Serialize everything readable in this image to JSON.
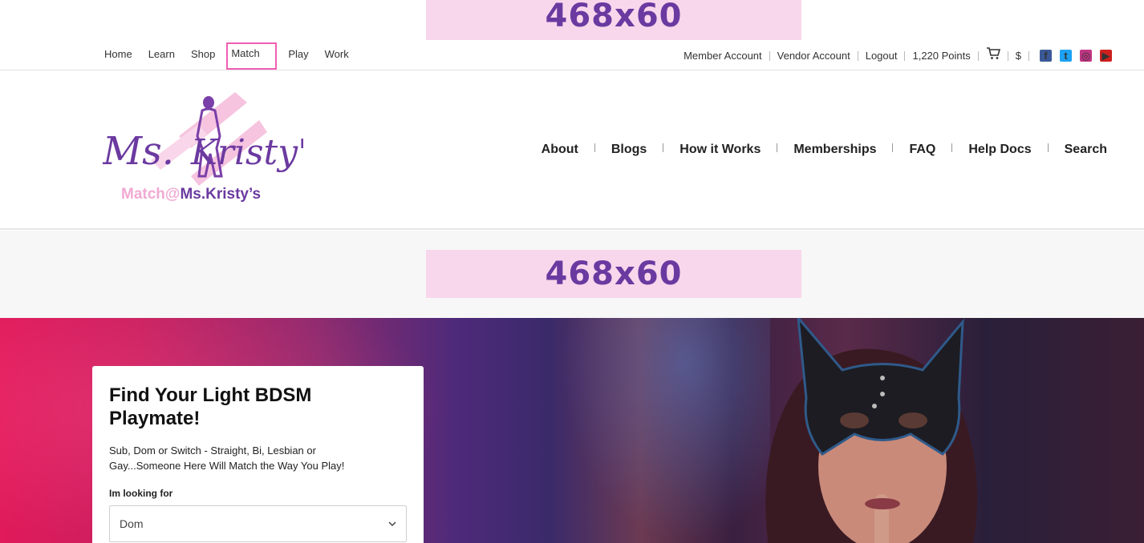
{
  "ads": {
    "top": "468x60",
    "middle": "468x60"
  },
  "topnav": {
    "left": [
      "Home",
      "Learn",
      "Shop",
      "Match",
      "Play",
      "Work"
    ],
    "active_index": 3,
    "right": {
      "member_account": "Member Account",
      "vendor_account": "Vendor Account",
      "logout": "Logout",
      "points": "1,220 Points",
      "cart_icon": "cart-icon",
      "currency": "$"
    },
    "social": [
      {
        "name": "facebook-icon",
        "glyph": "f",
        "color": "#3b5998"
      },
      {
        "name": "twitter-icon",
        "glyph": "t",
        "color": "#1da1f2"
      },
      {
        "name": "instagram-icon",
        "glyph": "◎",
        "color": "#c13584"
      },
      {
        "name": "youtube-icon",
        "glyph": "▶",
        "color": "#cd201f"
      }
    ]
  },
  "header": {
    "logo_text": "Ms.Kristy's",
    "logo_sub_prefix": "Match",
    "logo_sub_at": "@",
    "logo_sub_suffix": "Ms.Kristy’s",
    "nav": [
      "About",
      "Blogs",
      "How it Works",
      "Memberships",
      "FAQ",
      "Help Docs",
      "Search"
    ]
  },
  "hero": {
    "title": "Find Your Light BDSM Playmate!",
    "subtitle": "Sub, Dom or Switch - Straight, Bi, Lesbian or Gay...Someone Here Will Match the Way You Play!",
    "looking_label": "Im looking for",
    "looking_value": "Dom"
  },
  "colors": {
    "accent": "#6b3aa0",
    "ad_bg": "#f8d7ec",
    "active_outline": "#ef5fb2"
  }
}
